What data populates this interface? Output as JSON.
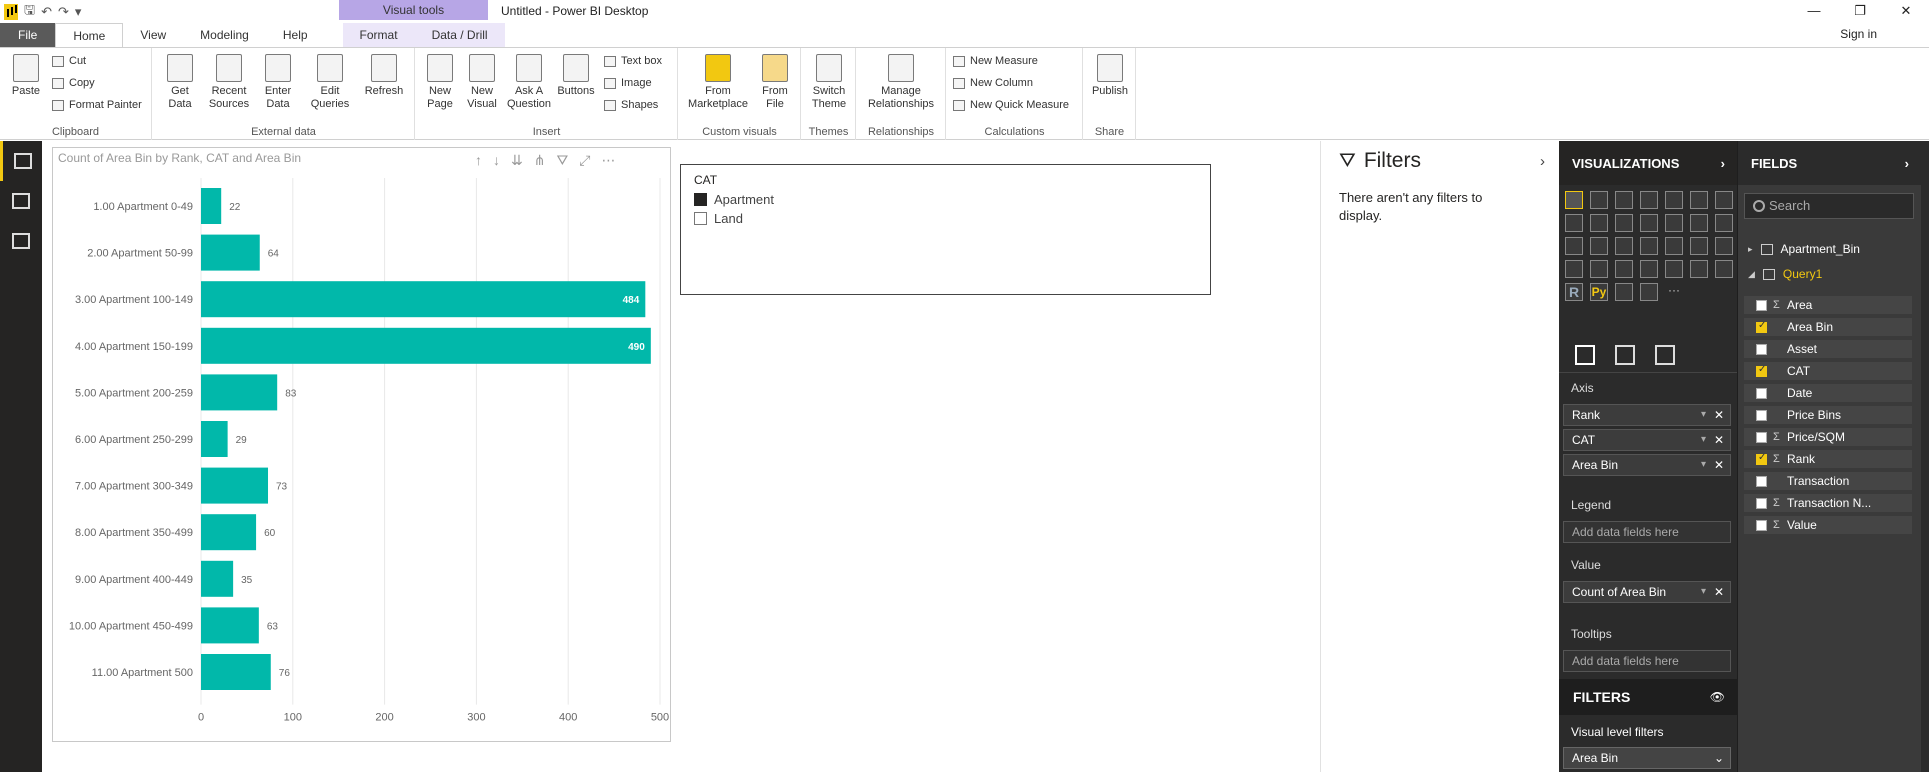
{
  "window": {
    "title": "Untitled - Power BI Desktop",
    "visual_tools": "Visual tools"
  },
  "tabs": [
    "File",
    "Home",
    "View",
    "Modeling",
    "Help",
    "Format",
    "Data / Drill"
  ],
  "signin": "Sign in",
  "ribbon": {
    "clipboard": {
      "label": "Clipboard",
      "paste": "Paste",
      "cut": "Cut",
      "copy": "Copy",
      "format_painter": "Format Painter"
    },
    "external": {
      "label": "External data",
      "get_data": "Get Data",
      "recent_sources": "Recent Sources",
      "enter_data": "Enter Data",
      "edit_queries": "Edit Queries",
      "refresh": "Refresh"
    },
    "insert": {
      "label": "Insert",
      "new_page": "New Page",
      "new_visual": "New Visual",
      "ask_question": "Ask A Question",
      "buttons": "Buttons",
      "text_box": "Text box",
      "image": "Image",
      "shapes": "Shapes"
    },
    "custom": {
      "label": "Custom visuals",
      "from_marketplace": "From Marketplace",
      "from_file": "From File"
    },
    "themes": {
      "label": "Themes",
      "switch_theme": "Switch Theme"
    },
    "relationships": {
      "label": "Relationships",
      "manage": "Manage Relationships"
    },
    "calculations": {
      "label": "Calculations",
      "new_measure": "New Measure",
      "new_column": "New Column",
      "new_quick_measure": "New Quick Measure"
    },
    "share": {
      "label": "Share",
      "publish": "Publish"
    }
  },
  "chart_data": {
    "type": "bar",
    "title": "Count of Area Bin by Rank, CAT and Area Bin",
    "categories": [
      "1.00 Apartment 0-49",
      "2.00 Apartment 50-99",
      "3.00 Apartment 100-149",
      "4.00 Apartment 150-199",
      "5.00 Apartment 200-259",
      "6.00 Apartment 250-299",
      "7.00 Apartment 300-349",
      "8.00 Apartment 350-499",
      "9.00 Apartment 400-449",
      "10.00 Apartment 450-499",
      "11.00 Apartment 500"
    ],
    "values": [
      22,
      64,
      484,
      490,
      83,
      29,
      73,
      60,
      35,
      63,
      76
    ],
    "xlim": [
      0,
      500
    ],
    "xticks": [
      0,
      100,
      200,
      300,
      400,
      500
    ],
    "bar_color": "#01b8aa",
    "grid": true
  },
  "slicer": {
    "header": "CAT",
    "options": [
      {
        "label": "Apartment",
        "checked": true
      },
      {
        "label": "Land",
        "checked": false
      }
    ]
  },
  "filters": {
    "title": "Filters",
    "empty_msg": "There aren't any filters to display."
  },
  "viz": {
    "title": "VISUALIZATIONS",
    "axis_label": "Axis",
    "axis": [
      "Rank",
      "CAT",
      "Area Bin"
    ],
    "legend_label": "Legend",
    "legend_ph": "Add data fields here",
    "value_label": "Value",
    "value": "Count of Area Bin",
    "tooltips_label": "Tooltips",
    "tooltips_ph": "Add data fields here",
    "filters_title": "FILTERS",
    "visual_level": "Visual level filters",
    "vl_field": "Area Bin",
    "r_label": "R",
    "py_label": "Py",
    "more": "···"
  },
  "fields": {
    "title": "FIELDS",
    "search_ph": "Search",
    "tables": [
      "Apartment_Bin",
      "Query1"
    ],
    "items": [
      {
        "name": "Area",
        "sigma": true,
        "checked": false
      },
      {
        "name": "Area Bin",
        "sigma": false,
        "checked": true
      },
      {
        "name": "Asset",
        "sigma": false,
        "checked": false
      },
      {
        "name": "CAT",
        "sigma": false,
        "checked": true
      },
      {
        "name": "Date",
        "sigma": false,
        "checked": false
      },
      {
        "name": "Price Bins",
        "sigma": false,
        "checked": false
      },
      {
        "name": "Price/SQM",
        "sigma": true,
        "checked": false
      },
      {
        "name": "Rank",
        "sigma": true,
        "checked": true
      },
      {
        "name": "Transaction",
        "sigma": false,
        "checked": false
      },
      {
        "name": "Transaction N...",
        "sigma": true,
        "checked": false
      },
      {
        "name": "Value",
        "sigma": true,
        "checked": false
      }
    ]
  }
}
